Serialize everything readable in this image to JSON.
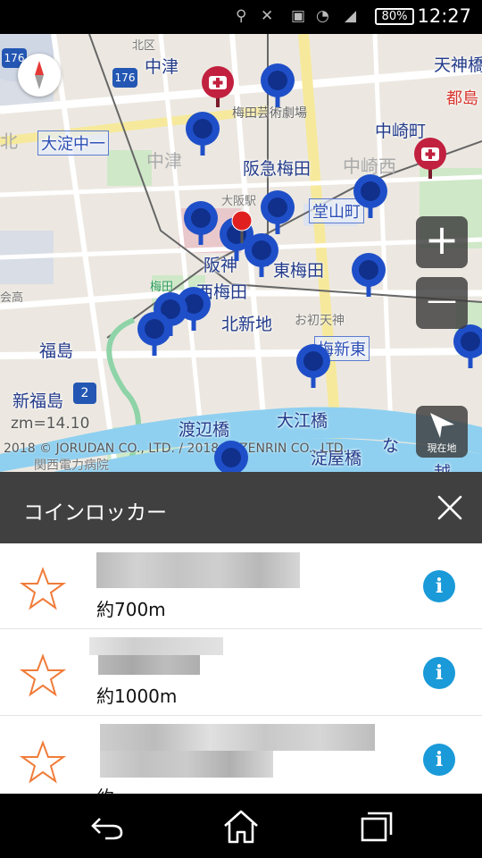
{
  "status_bar": {
    "battery": "80%",
    "time": "12:27"
  },
  "map": {
    "labels": {
      "nakatsu": "中津",
      "nakatsu_gray": "中津",
      "hankyu_umeda": "阪急梅田",
      "hanshin": "阪神",
      "nishiumeda": "西梅田",
      "kitashinchi": "北新地",
      "higashiumeda": "東梅田",
      "ohatsutenjin": "お初天神",
      "umeshinhigashi": "梅新東",
      "nakazakicho": "中崎町",
      "nakazakinishi": "中崎西",
      "tenjinbashi": "天神橋",
      "miyakojima": "都島",
      "kitaku": "北区",
      "umeda_geijutsu": "梅田芸術劇場",
      "osaka_station": "大阪駅",
      "dojimacho": "堂山町",
      "fukushima": "福島",
      "shinfukushima": "新福島",
      "watanabebashi": "渡辺橋",
      "oebashi": "大江橋",
      "yodoyabashi": "淀屋橋",
      "kandai": "関西電力病院",
      "yodo_naka": "大淀中一",
      "kasai": "会高",
      "umeda": "梅田",
      "kita_left": "北",
      "nani": "な",
      "koshi": "越"
    },
    "zoom_text": "zm=14.10",
    "copyright": "2018 © JORUDAN CO., LTD. / 2018 © ZENRIN CO., LTD.",
    "route_176_a": "176",
    "route_176_b": "176",
    "route_2": "2",
    "zoom_in": "+",
    "zoom_out": "—",
    "current_location": "現在地"
  },
  "panel": {
    "title": "コインロッカー"
  },
  "list": {
    "items": [
      {
        "distance": "約700m"
      },
      {
        "distance": "約1000m"
      },
      {
        "distance": "約"
      }
    ]
  },
  "colors": {
    "pin_blue": "#1f4fc8",
    "hospital_red": "#c2203f",
    "info_blue": "#1a9ad8",
    "star_orange": "#f07c3a",
    "header_dark": "#404040"
  }
}
